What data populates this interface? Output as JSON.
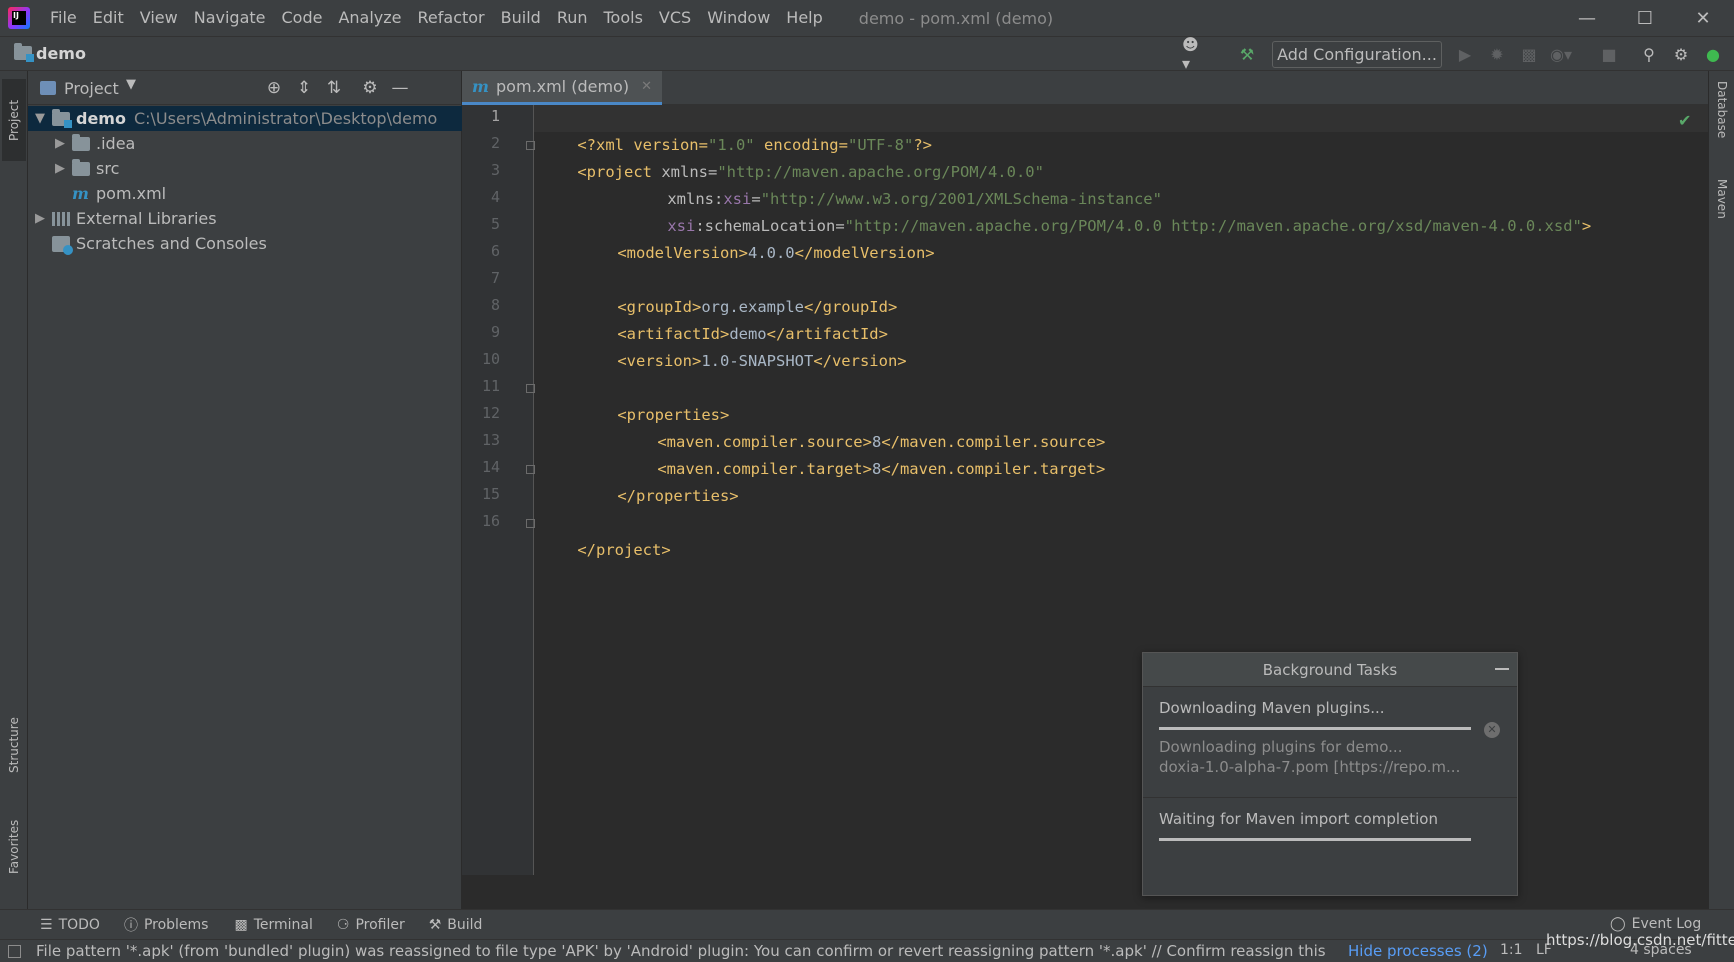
{
  "menu": [
    "File",
    "Edit",
    "View",
    "Navigate",
    "Code",
    "Analyze",
    "Refactor",
    "Build",
    "Run",
    "Tools",
    "VCS",
    "Window",
    "Help"
  ],
  "window_title": "demo - pom.xml (demo)",
  "navbar": {
    "project": "demo",
    "add_configuration": "Add Configuration..."
  },
  "left_strip": {
    "project": "Project",
    "structure": "Structure",
    "favorites": "Favorites"
  },
  "right_strip": {
    "database": "Database",
    "maven": "Maven"
  },
  "project_panel": {
    "title": "Project",
    "tree": [
      {
        "label": "demo",
        "path": "C:\\Users\\Administrator\\Desktop\\demo"
      },
      {
        "label": ".idea"
      },
      {
        "label": "src"
      },
      {
        "label": "pom.xml"
      },
      {
        "label": "External Libraries"
      },
      {
        "label": "Scratches and Consoles"
      }
    ]
  },
  "editor": {
    "tab": "pom.xml (demo)",
    "line_numbers": [
      "1",
      "2",
      "3",
      "4",
      "5",
      "6",
      "7",
      "8",
      "9",
      "10",
      "11",
      "12",
      "13",
      "14",
      "15",
      "16"
    ],
    "code": {
      "l1": [
        "<?xml version=",
        "\"1.0\"",
        " encoding=",
        "\"UTF-8\"",
        "?>"
      ],
      "l2": [
        "<project ",
        "xmlns",
        "=",
        "\"http://maven.apache.org/POM/4.0.0\""
      ],
      "l3": [
        "xmlns",
        ":",
        "xsi",
        "=",
        "\"http://www.w3.org/2001/XMLSchema-instance\""
      ],
      "l4": [
        "xsi",
        ":schemaLocation",
        "=",
        "\"http://maven.apache.org/POM/4.0.0 http://maven.apache.org/xsd/maven-4.0.0.xsd\"",
        ">"
      ],
      "l5": [
        "<modelVersion>",
        "4.0.0",
        "</modelVersion>"
      ],
      "l7": [
        "<groupId>",
        "org.example",
        "</groupId>"
      ],
      "l8": [
        "<artifactId>",
        "demo",
        "</artifactId>"
      ],
      "l9": [
        "<version>",
        "1.0-SNAPSHOT",
        "</version>"
      ],
      "l11": [
        "<properties>"
      ],
      "l12": [
        "<maven.compiler.source>",
        "8",
        "</maven.compiler.source>"
      ],
      "l13": [
        "<maven.compiler.target>",
        "8",
        "</maven.compiler.target>"
      ],
      "l14": [
        "</properties>"
      ],
      "l16": [
        "</project>"
      ]
    }
  },
  "background_tasks": {
    "title": "Background Tasks",
    "task1": {
      "title": "Downloading Maven plugins...",
      "detail1": "Downloading plugins for demo...",
      "detail2": "doxia-1.0-alpha-7.pom [https://repo.m...",
      "progress": 1.0
    },
    "task2": {
      "title": "Waiting for Maven import completion",
      "progress": 1.0
    }
  },
  "bottom_tools": [
    "TODO",
    "Problems",
    "Terminal",
    "Profiler",
    "Build"
  ],
  "event_log": "Event Log",
  "status": {
    "message": "File pattern '*.apk' (from 'bundled' plugin) was reassigned to file type 'APK' by 'Android' plugin: You can confirm or revert reassigning pattern '*.apk' // Confirm reassign this patte",
    "hide_processes": "Hide processes (2)",
    "caret": "1:1",
    "line_sep": "LF",
    "indent": "4 spaces"
  },
  "watermark": "https://blog.csdn.net/fittec",
  "colors": {
    "tag": "#e8bf6a",
    "value": "#6a8759",
    "namespace": "#9876aa",
    "link": "#589df6"
  }
}
